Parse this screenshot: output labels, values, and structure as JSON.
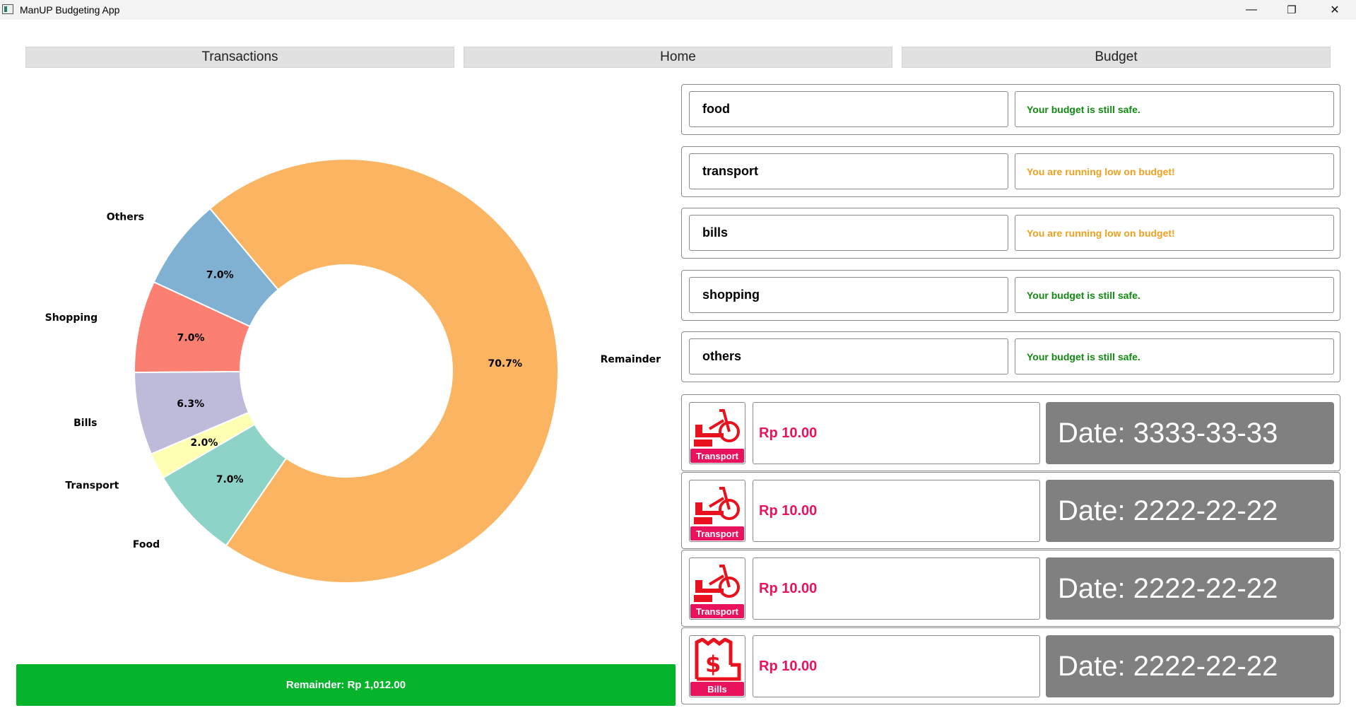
{
  "window": {
    "title": "ManUP Budgeting App",
    "minimize_symbol": "—",
    "maximize_symbol": "❐",
    "close_symbol": "✕"
  },
  "nav": {
    "transactions": "Transactions",
    "home": "Home",
    "budget": "Budget"
  },
  "chart_data": {
    "type": "pie",
    "donut": true,
    "categories": [
      "Remainder",
      "Others",
      "Shopping",
      "Bills",
      "Transport",
      "Food"
    ],
    "values": [
      70.7,
      7.0,
      7.0,
      6.3,
      2.0,
      7.0
    ],
    "value_labels": [
      "70.7%",
      "7.0%",
      "7.0%",
      "6.3%",
      "2.0%",
      "7.0%"
    ],
    "colors": [
      "#fbb461",
      "#80b1d3",
      "#fb8072",
      "#bebada",
      "#ffffb3",
      "#8dd3c7"
    ]
  },
  "remainder": "Remainder: Rp 1,012.00",
  "budgets": [
    {
      "name": "food",
      "status": "Your budget is still safe.",
      "status_color": "#118a11"
    },
    {
      "name": "transport",
      "status": "You are running low on budget!",
      "status_color": "#f0a020"
    },
    {
      "name": "bills",
      "status": "You are running low on budget!",
      "status_color": "#f0a020"
    },
    {
      "name": "shopping",
      "status": "Your budget is still safe.",
      "status_color": "#118a11"
    },
    {
      "name": "others",
      "status": "Your budget is still safe.",
      "status_color": "#118a11"
    }
  ],
  "transactions": [
    {
      "category": "Transport",
      "icon": "scooter-icon",
      "amount": "Rp 10.00",
      "date": "Date: 3333-33-33"
    },
    {
      "category": "Transport",
      "icon": "scooter-icon",
      "amount": "Rp 10.00",
      "date": "Date: 2222-22-22"
    },
    {
      "category": "Transport",
      "icon": "scooter-icon",
      "amount": "Rp 10.00",
      "date": "Date: 2222-22-22"
    },
    {
      "category": "Bills",
      "icon": "bill-receipt-icon",
      "amount": "Rp 10.00",
      "date": "Date: 2222-22-22"
    }
  ],
  "colors": {
    "accent_pink": "#e8125f",
    "icon_red": "#e8121e",
    "remainder_green": "#06b42c",
    "date_gray": "#808080"
  }
}
